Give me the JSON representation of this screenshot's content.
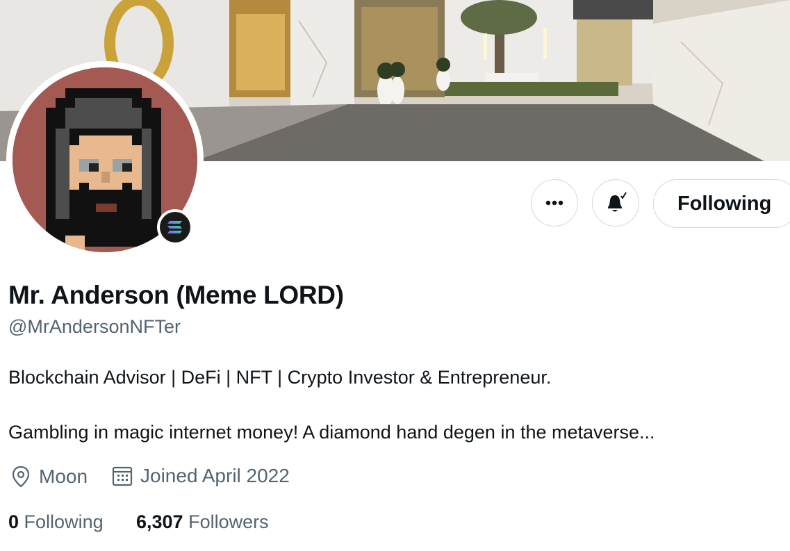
{
  "profile": {
    "display_name": "Mr. Anderson (Meme LORD)",
    "handle": "@MrAndersonNFTer",
    "bio_line1": "Blockchain Advisor | DeFi | NFT | Crypto Investor & Entrepreneur.",
    "bio_line2": "Gambling in magic internet money! A diamond hand degen in the metaverse...",
    "location": "Moon",
    "joined": "Joined April 2022",
    "following_count": "0",
    "following_label": "Following",
    "followers_count": "6,307",
    "followers_label": "Followers"
  },
  "actions": {
    "more_icon": "more-horizontal-icon",
    "bell_icon": "notification-bell-icon",
    "follow_label": "Following"
  },
  "colors": {
    "text_primary": "#0f1419",
    "text_secondary": "#536471",
    "border": "#cfd9de",
    "avatar_bg": "#a45a52"
  }
}
